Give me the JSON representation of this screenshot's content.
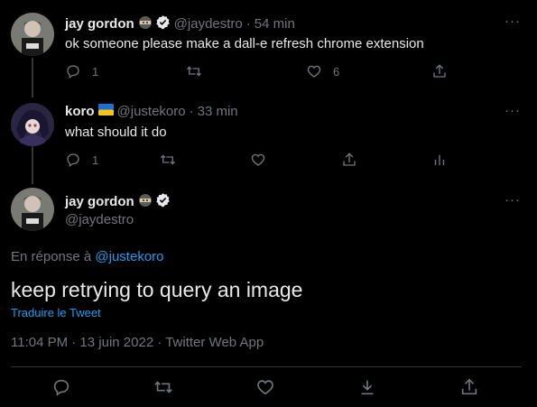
{
  "tweets": [
    {
      "name": "jay gordon",
      "handle": "@jaydestro",
      "sep": "·",
      "time": "54 min",
      "text": "ok someone please make a dall-e refresh chrome extension",
      "reply_count": "1",
      "like_count": "6",
      "more": "···"
    },
    {
      "name": "koro",
      "handle": "@justekoro",
      "sep": "·",
      "time": "33 min",
      "text": "what should it do",
      "reply_count": "1",
      "more": "···"
    }
  ],
  "main": {
    "name": "jay gordon",
    "handle": "@jaydestro",
    "more": "···",
    "reply_prefix": "En réponse à",
    "reply_mention": "@justekoro",
    "text": "keep retrying to query an image",
    "translate": "Traduire le Tweet",
    "meta": "11:04 PM · 13 juin 2022 · Twitter Web App"
  },
  "colors": {
    "background": "#000000",
    "text": "#e7e9ea",
    "muted": "#71767b",
    "accent": "#1d9bf0",
    "verified": "#e7e9ea"
  },
  "icons": [
    "reply-icon",
    "retweet-icon",
    "like-icon",
    "share-icon",
    "analytics-icon",
    "bookmark-icon",
    "verified-icon",
    "ninja-emoji",
    "ukraine-flag-emoji",
    "more-icon"
  ]
}
